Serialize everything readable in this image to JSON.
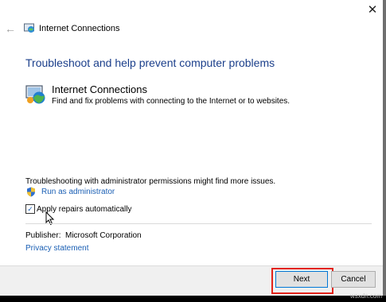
{
  "window": {
    "title": "Internet Connections",
    "close_glyph": "✕",
    "back_glyph": "←"
  },
  "main": {
    "heading": "Troubleshoot and help prevent computer problems",
    "item": {
      "title": "Internet Connections",
      "description": "Find and fix problems with connecting to the Internet or to websites.",
      "icon": "internet-connections-icon"
    },
    "admin_note": "Troubleshooting with administrator permissions might find more issues.",
    "run_as_admin": "Run as administrator",
    "apply_repairs": {
      "label": "Apply repairs automatically",
      "checked": true,
      "check_glyph": "✓"
    },
    "publisher_label": "Publisher:",
    "publisher_value": "Microsoft Corporation",
    "privacy_link": "Privacy statement"
  },
  "footer": {
    "next_label": "Next",
    "cancel_label": "Cancel"
  },
  "watermark": "wsxdn.com",
  "colors": {
    "heading": "#1b3f8b",
    "link": "#1a5fb4",
    "highlight": "#e2231a",
    "footer_bg": "#f0f0f0"
  }
}
